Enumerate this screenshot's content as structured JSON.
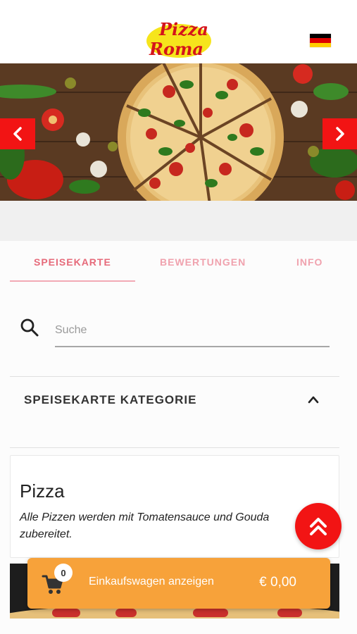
{
  "header": {
    "logo_line1": "Pizza",
    "logo_line2": "Roma",
    "language_flag": "german-flag-icon",
    "flag_colors": [
      "#000000",
      "#dd0000",
      "#ffce00"
    ]
  },
  "hero": {
    "prev_icon": "chevron-left-icon",
    "next_icon": "chevron-right-icon"
  },
  "tabs": [
    {
      "label": "SPEISEKARTE",
      "active": true
    },
    {
      "label": "BEWERTUNGEN",
      "active": false
    },
    {
      "label": "INFO",
      "active": false
    }
  ],
  "search": {
    "placeholder": "Suche",
    "value": "",
    "icon": "search-icon"
  },
  "category": {
    "title": "SPEISEKARTE KATEGORIE",
    "icon": "chevron-up-icon"
  },
  "menu_section": {
    "title": "Pizza",
    "description": "Alle Pizzen werden mit Tomatensauce und Gouda zubereitet."
  },
  "scroll_top": {
    "icon": "double-chevron-up-icon"
  },
  "cart": {
    "count": "0",
    "label": "Einkaufswagen anzeigen",
    "total": "€ 0,00",
    "icon": "shopping-cart-icon"
  },
  "colors": {
    "accent_red": "#f21414",
    "tab_active": "#e66a7a",
    "tab_inactive": "#f0a2ae",
    "cart_orange": "#f7a23a"
  }
}
